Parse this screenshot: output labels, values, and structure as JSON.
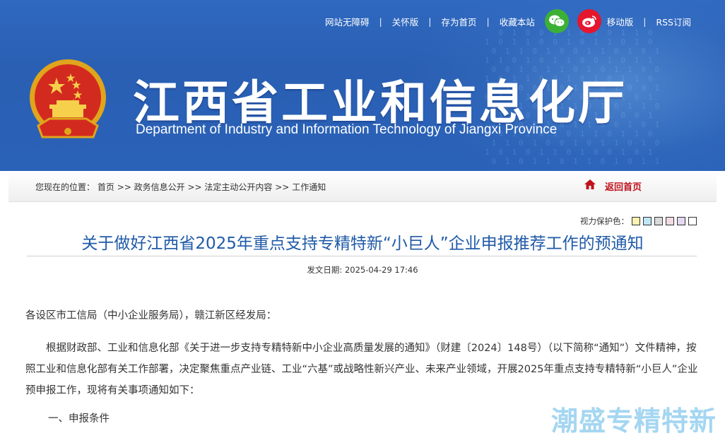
{
  "topnav": {
    "items": [
      "网站无障碍",
      "关怀版",
      "存为首页",
      "收藏本站"
    ],
    "mobile": "移动版",
    "rss": "RSS订阅",
    "wechat_icon": "wechat-icon",
    "weibo_icon": "weibo-icon"
  },
  "header": {
    "title_cn": "江西省工业和信息化厅",
    "title_en": "Department of Industry and Information Technology of Jiangxi Province"
  },
  "breadcrumb": {
    "prefix": "您现在的位置：",
    "items": [
      "首页",
      "政务信息公开",
      "法定主动公开内容",
      "工作通知"
    ],
    "seps": [
      ">>",
      " >>",
      " >>"
    ],
    "home_label": "返回首页"
  },
  "vision": {
    "label": "视力保护色：",
    "colors": [
      "#fbf1b0",
      "#bfe6f7",
      "#d9d9d9",
      "#f1dbe2",
      "#e4d9f1",
      "#ffffff"
    ]
  },
  "article": {
    "title": "关于做好江西省2025年重点支持专精特新“小巨人”企业申报推荐工作的预通知",
    "date_label": "发文日期:",
    "date": "2025-04-29 17:46",
    "salutation": "各设区市工信局（中小企业服务局），赣江新区经发局：",
    "para1": "根据财政部、工业和信息化部《关于进一步支持专精特新中小企业高质量发展的通知》（财建〔2024〕148号）（以下简称“通知”）文件精神，按照工业和信息化部有关工作部署，决定聚焦重点产业链、工业“六基”或战略性新兴产业、未来产业领域，开展2025年重点支持专精特新“小巨人”企业预申报工作，现将有关事项通知如下：",
    "section1": "一、申报条件"
  },
  "watermark": "潮盛专精特新",
  "colors": {
    "header_blue": "#2f69c0",
    "title_blue": "#1f5aa8",
    "home_red": "#c0121d"
  }
}
